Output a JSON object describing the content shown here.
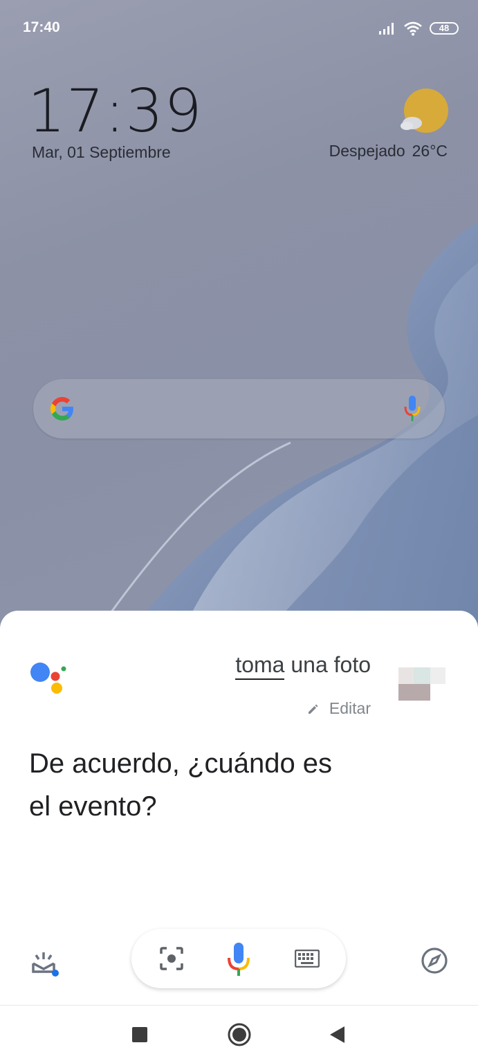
{
  "status_bar": {
    "time": "17:40",
    "battery": "48",
    "icons": [
      "signal-icon",
      "wifi-icon",
      "battery-icon"
    ]
  },
  "lockscreen": {
    "clock": "17:39",
    "date": "Mar, 01 Septiembre",
    "weather_condition": "Despejado",
    "temperature": "26°C",
    "weather_icon": "sun-cloud-icon"
  },
  "search_widget": {
    "icons": [
      "google-g-icon",
      "mic-icon"
    ]
  },
  "assistant": {
    "query_underlined": "toma",
    "query_rest": " una foto",
    "edit_label": "Editar",
    "response_line1": "De acuerdo, ¿cuándo es",
    "response_line2": "el evento?"
  },
  "bottom_bar": {
    "icons": [
      "updates-icon",
      "lens-icon",
      "mic-icon",
      "keyboard-icon",
      "explore-compass-icon"
    ]
  },
  "nav_bar": {
    "icons": [
      "recents-square-icon",
      "home-circle-icon",
      "back-triangle-icon"
    ]
  },
  "colors": {
    "google_blue": "#4285F4",
    "google_red": "#EA4335",
    "google_yellow": "#FBBC05",
    "google_green": "#34A853"
  }
}
